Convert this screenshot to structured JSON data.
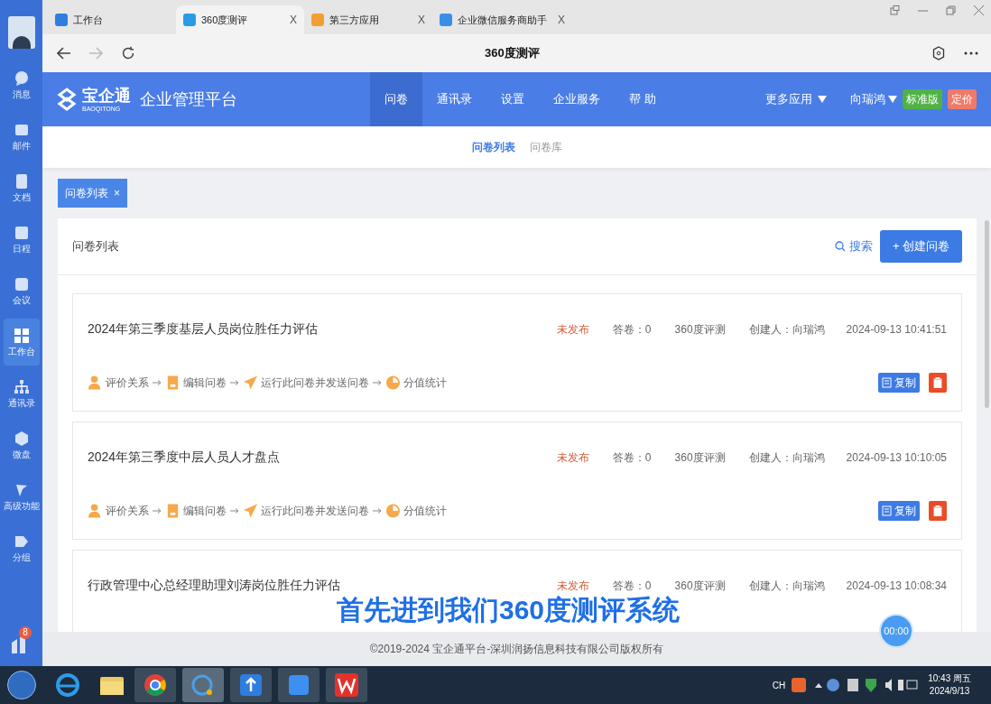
{
  "sidebar": {
    "items": [
      {
        "label": "消息",
        "selected": false
      },
      {
        "label": "邮件",
        "selected": false
      },
      {
        "label": "文档",
        "selected": false
      },
      {
        "label": "日程",
        "selected": false
      },
      {
        "label": "会议",
        "selected": false
      },
      {
        "label": "工作台",
        "selected": true
      },
      {
        "label": "通讯录",
        "selected": false
      },
      {
        "label": "微盘",
        "selected": false
      },
      {
        "label": "高级功能",
        "selected": false
      },
      {
        "label": "分组",
        "selected": false
      }
    ],
    "badge": "8"
  },
  "browser": {
    "tabs": [
      {
        "label": "工作台",
        "selected": false
      },
      {
        "label": "360度测评",
        "selected": true,
        "close": "X"
      },
      {
        "label": "第三方应用",
        "selected": false,
        "close": "X"
      },
      {
        "label": "企业微信服务商助手",
        "selected": false,
        "close": "X"
      }
    ],
    "page_title": "360度测评"
  },
  "header": {
    "logo": "宝企通",
    "logo_sub": "BAOQITONG",
    "platform": "企业管理平台",
    "nav": [
      {
        "label": "问卷",
        "selected": true
      },
      {
        "label": "通讯录",
        "selected": false
      },
      {
        "label": "设置",
        "selected": false
      },
      {
        "label": "企业服务",
        "selected": false
      },
      {
        "label": "帮 助",
        "selected": false
      }
    ],
    "more_apps": "更多应用",
    "user": "向瑞鸿",
    "edition": "标准版",
    "pricing": "定价"
  },
  "subnav": [
    {
      "label": "问卷列表",
      "selected": true
    },
    {
      "label": "问卷库",
      "selected": false
    }
  ],
  "open_tags": [
    {
      "label": "问卷列表",
      "close": "×"
    }
  ],
  "panel": {
    "title": "问卷列表",
    "search": "搜索",
    "create": "+ 创建问卷"
  },
  "surveys": [
    {
      "title": "2024年第三季度基层人员岗位胜任力评估",
      "status": "未发布",
      "answers": "答卷：0",
      "type": "360度评测",
      "creator": "创建人：向瑞鸿",
      "time": "2024-09-13 10:41:51",
      "steps": [
        "评价关系",
        "编辑问卷",
        "运行此问卷并发送问卷",
        "分值统计"
      ],
      "copy": "复制"
    },
    {
      "title": "2024年第三季度中层人员人才盘点",
      "status": "未发布",
      "answers": "答卷：0",
      "type": "360度评测",
      "creator": "创建人：向瑞鸿",
      "time": "2024-09-13 10:10:05",
      "steps": [
        "评价关系",
        "编辑问卷",
        "运行此问卷并发送问卷",
        "分值统计"
      ],
      "copy": "复制"
    },
    {
      "title": "行政管理中心总经理助理刘涛岗位胜任力评估",
      "status": "未发布",
      "answers": "答卷：0",
      "type": "360度评测",
      "creator": "创建人：向瑞鸿",
      "time": "2024-09-13 10:08:34"
    }
  ],
  "footer": "©2019-2024 宝企通平台-深圳润扬信息科技有限公司版权所有",
  "subtitle": "首先进到我们360度测评系统",
  "timer": "00:00",
  "taskbar": {
    "lang": "CH",
    "time": "10:43 周五",
    "date": "2024/9/13"
  }
}
